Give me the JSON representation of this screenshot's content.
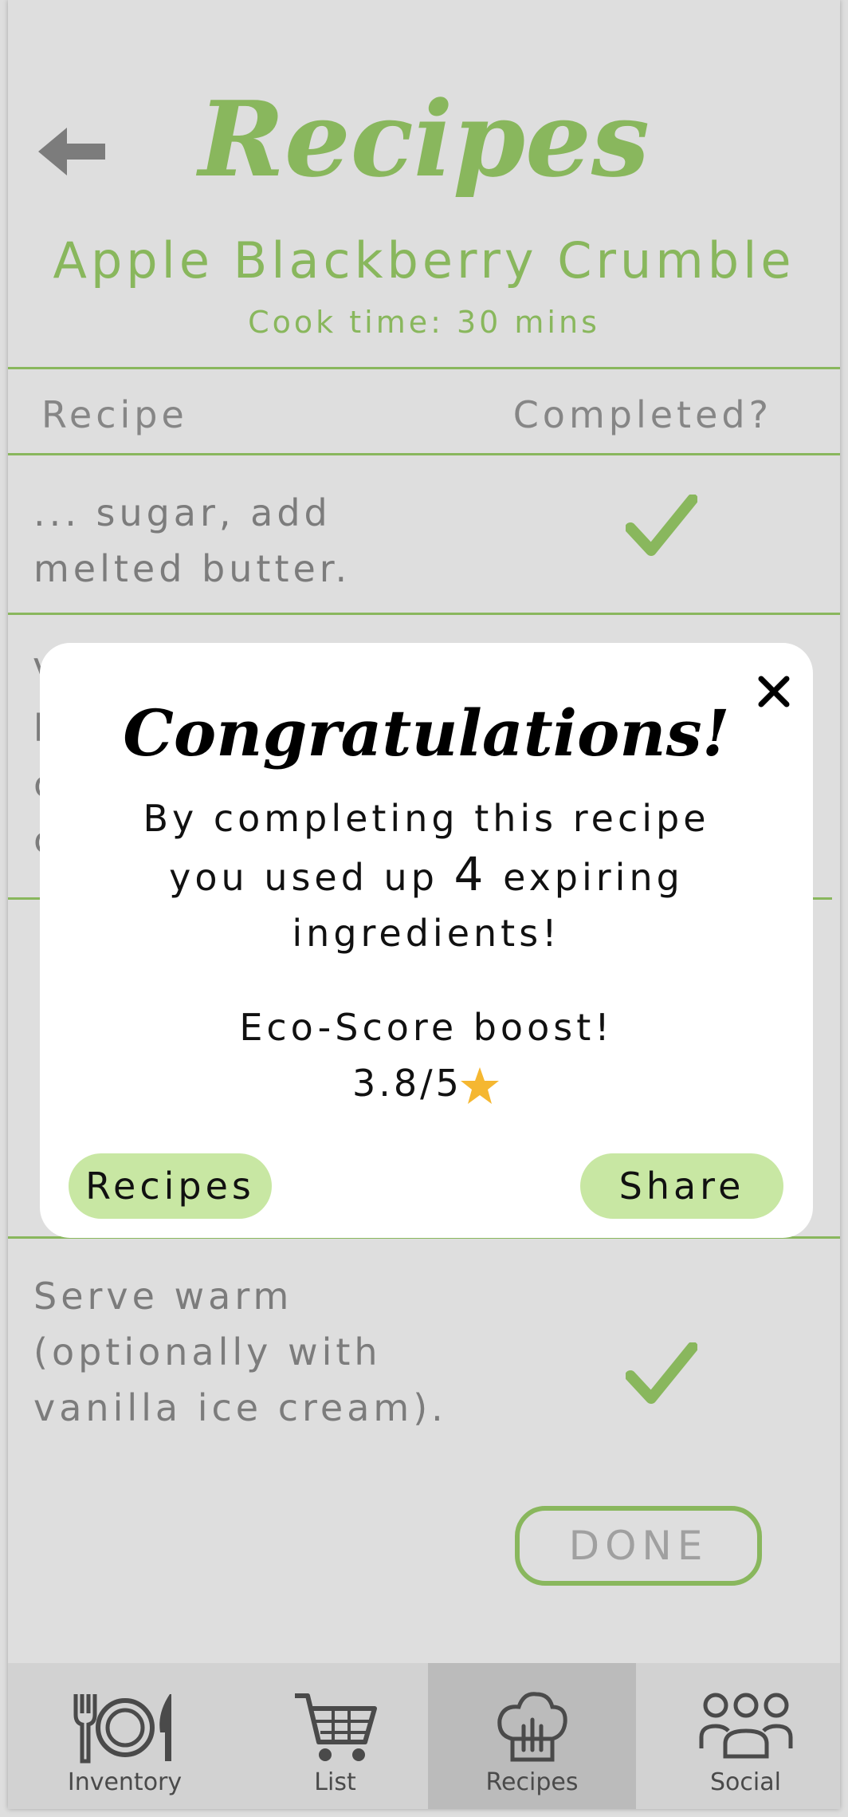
{
  "header": {
    "title": "Recipes"
  },
  "recipe": {
    "name": "Apple Blackberry Crumble",
    "cook_time": "Cook time: 30 mins"
  },
  "columns": {
    "recipe": "Recipe",
    "completed": "Completed?"
  },
  "steps": [
    {
      "line1": "... sugar, add",
      "line2": "melted butter.",
      "line3": ""
    },
    {
      "line1": "Serve warm",
      "line2": "(optionally with",
      "line3": "vanilla ice cream)."
    }
  ],
  "partial_step": {
    "c1": "V",
    "c2": "b",
    "c3": "c",
    "c4": "c"
  },
  "done_label": "DONE",
  "nav": {
    "items": [
      {
        "label": "Inventory",
        "icon": "plate-utensils-icon"
      },
      {
        "label": "List",
        "icon": "cart-icon"
      },
      {
        "label": "Recipes",
        "icon": "chef-hat-icon"
      },
      {
        "label": "Social",
        "icon": "people-icon"
      }
    ],
    "active": "Recipes"
  },
  "modal": {
    "title": "Congratulations!",
    "msg_part1": "By completing this recipe you used up",
    "count": "4",
    "msg_part2": "expiring ingredients!",
    "eco_label": "Eco-Score boost!",
    "eco_score": "3.8/5",
    "recipes_button": "Recipes",
    "share_button": "Share",
    "close_icon": "close-icon",
    "star_icon": "star-icon"
  },
  "colors": {
    "accent": "#9ed36b",
    "button_fill": "#c8e7a3",
    "star": "#f5b731"
  }
}
